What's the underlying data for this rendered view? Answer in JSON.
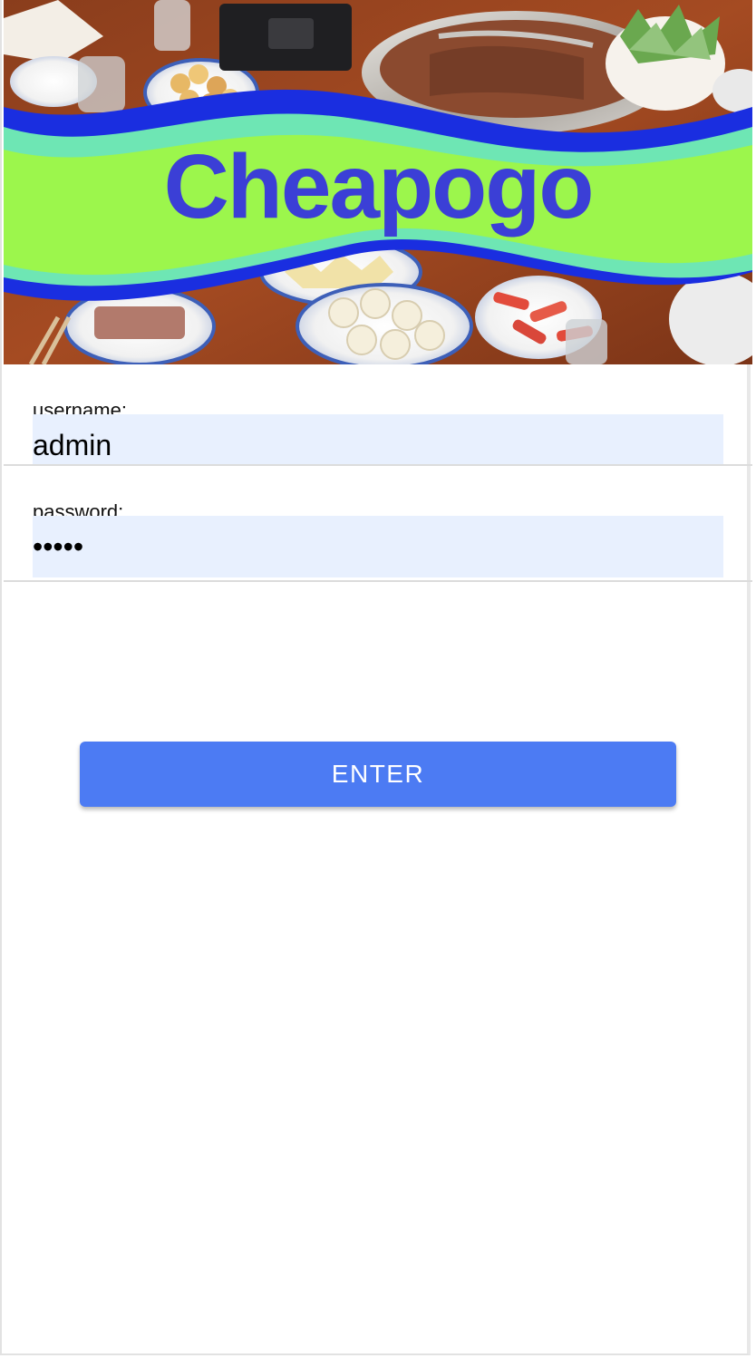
{
  "app": {
    "title": "Cheapogo"
  },
  "login": {
    "username_label": "username:",
    "username_value": "admin",
    "password_label": "password:",
    "password_value": "•••••",
    "enter_label": "ENTER"
  },
  "theme": {
    "accent": "#4c7bf3",
    "logo_text_color": "#3b3fd6",
    "wave_green": "#9cf64c",
    "wave_teal": "#6ee6b4",
    "wave_blue": "#1a2ee0",
    "input_bg": "#e8f0fe"
  }
}
